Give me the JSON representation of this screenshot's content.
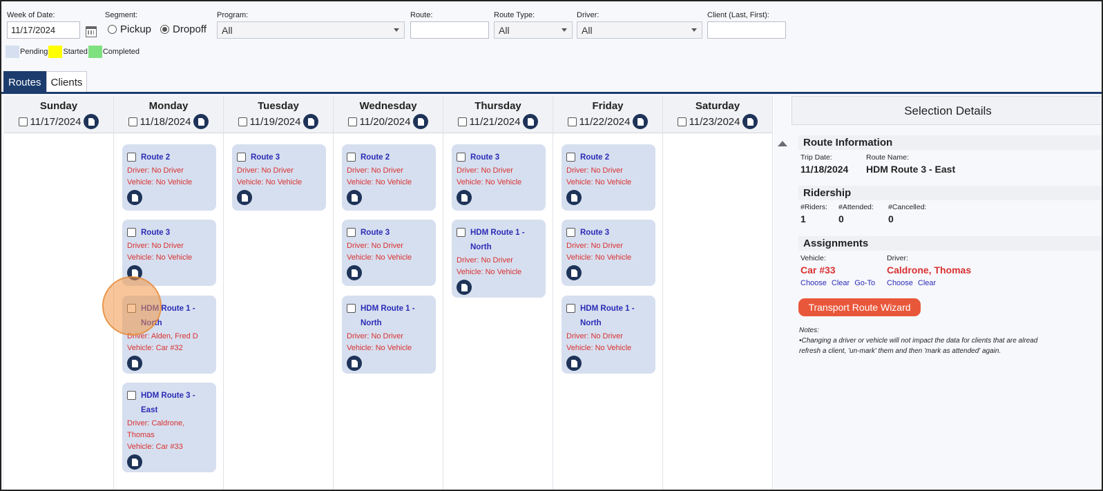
{
  "filters": {
    "week_label": "Week of Date:",
    "week_value": "11/17/2024",
    "segment_label": "Segment:",
    "segment_pickup": "Pickup",
    "segment_dropoff": "Dropoff",
    "program_label": "Program:",
    "program_value": "All",
    "route_label": "Route:",
    "route_value": "",
    "route_type_label": "Route Type:",
    "route_type_value": "All",
    "driver_label": "Driver:",
    "driver_value": "All",
    "client_label": "Client (Last, First):",
    "client_value": ""
  },
  "legend": {
    "pending": "Pending",
    "started": "Started",
    "completed": "Completed",
    "pending_color": "#d6dfef",
    "started_color": "#ffff00",
    "completed_color": "#7fe07f"
  },
  "tabs": {
    "routes": "Routes",
    "clients": "Clients"
  },
  "days": [
    {
      "name": "Sunday",
      "date": "11/17/2024"
    },
    {
      "name": "Monday",
      "date": "11/18/2024"
    },
    {
      "name": "Tuesday",
      "date": "11/19/2024"
    },
    {
      "name": "Wednesday",
      "date": "11/20/2024"
    },
    {
      "name": "Thursday",
      "date": "11/21/2024"
    },
    {
      "name": "Friday",
      "date": "11/22/2024"
    },
    {
      "name": "Saturday",
      "date": "11/23/2024"
    }
  ],
  "routes": {
    "mon": [
      {
        "name": "Route 2",
        "driver": "Driver: No Driver",
        "vehicle": "Vehicle: No Vehicle"
      },
      {
        "name": "Route 3",
        "driver": "Driver: No Driver",
        "vehicle": "Vehicle: No Vehicle"
      },
      {
        "name": "HDM Route 1 - North",
        "driver": "Driver: Alden, Fred D",
        "vehicle": "Vehicle: Car #32"
      },
      {
        "name": "HDM Route 3 - East",
        "driver": "Driver: Caldrone, Thomas",
        "vehicle": "Vehicle: Car #33"
      }
    ],
    "tue": [
      {
        "name": "Route 3",
        "driver": "Driver: No Driver",
        "vehicle": "Vehicle: No Vehicle"
      }
    ],
    "wed": [
      {
        "name": "Route 2",
        "driver": "Driver: No Driver",
        "vehicle": "Vehicle: No Vehicle"
      },
      {
        "name": "Route 3",
        "driver": "Driver: No Driver",
        "vehicle": "Vehicle: No Vehicle"
      },
      {
        "name": "HDM Route 1 - North",
        "driver": "Driver: No Driver",
        "vehicle": "Vehicle: No Vehicle"
      }
    ],
    "thu": [
      {
        "name": "Route 3",
        "driver": "Driver: No Driver",
        "vehicle": "Vehicle: No Vehicle"
      },
      {
        "name": "HDM Route 1 - North",
        "driver": "Driver: No Driver",
        "vehicle": "Vehicle: No Vehicle"
      }
    ],
    "fri": [
      {
        "name": "Route 2",
        "driver": "Driver: No Driver",
        "vehicle": "Vehicle: No Vehicle"
      },
      {
        "name": "Route 3",
        "driver": "Driver: No Driver",
        "vehicle": "Vehicle: No Vehicle"
      },
      {
        "name": "HDM Route 1 - North",
        "driver": "Driver: No Driver",
        "vehicle": "Vehicle: No Vehicle"
      }
    ]
  },
  "details": {
    "title": "Selection Details",
    "route_info": "Route Information",
    "trip_date_label": "Trip Date:",
    "trip_date": "11/18/2024",
    "route_name_label": "Route Name:",
    "route_name": "HDM Route 3 - East",
    "ridership": "Ridership",
    "riders_label": "#Riders:",
    "riders": "1",
    "attended_label": "#Attended:",
    "attended": "0",
    "cancelled_label": "#Cancelled:",
    "cancelled": "0",
    "assignments": "Assignments",
    "vehicle_label": "Vehicle:",
    "vehicle": "Car #33",
    "driver_label": "Driver:",
    "driver": "Caldrone, Thomas",
    "choose": "Choose",
    "clear": "Clear",
    "goto": "Go-To",
    "wizard": "Transport Route Wizard",
    "notes_label": "Notes:",
    "note1": "•Changing a driver or vehicle will not impact the data for clients that are alread",
    "note2": "refresh a client, 'un-mark' them and then 'mark as attended' again."
  }
}
